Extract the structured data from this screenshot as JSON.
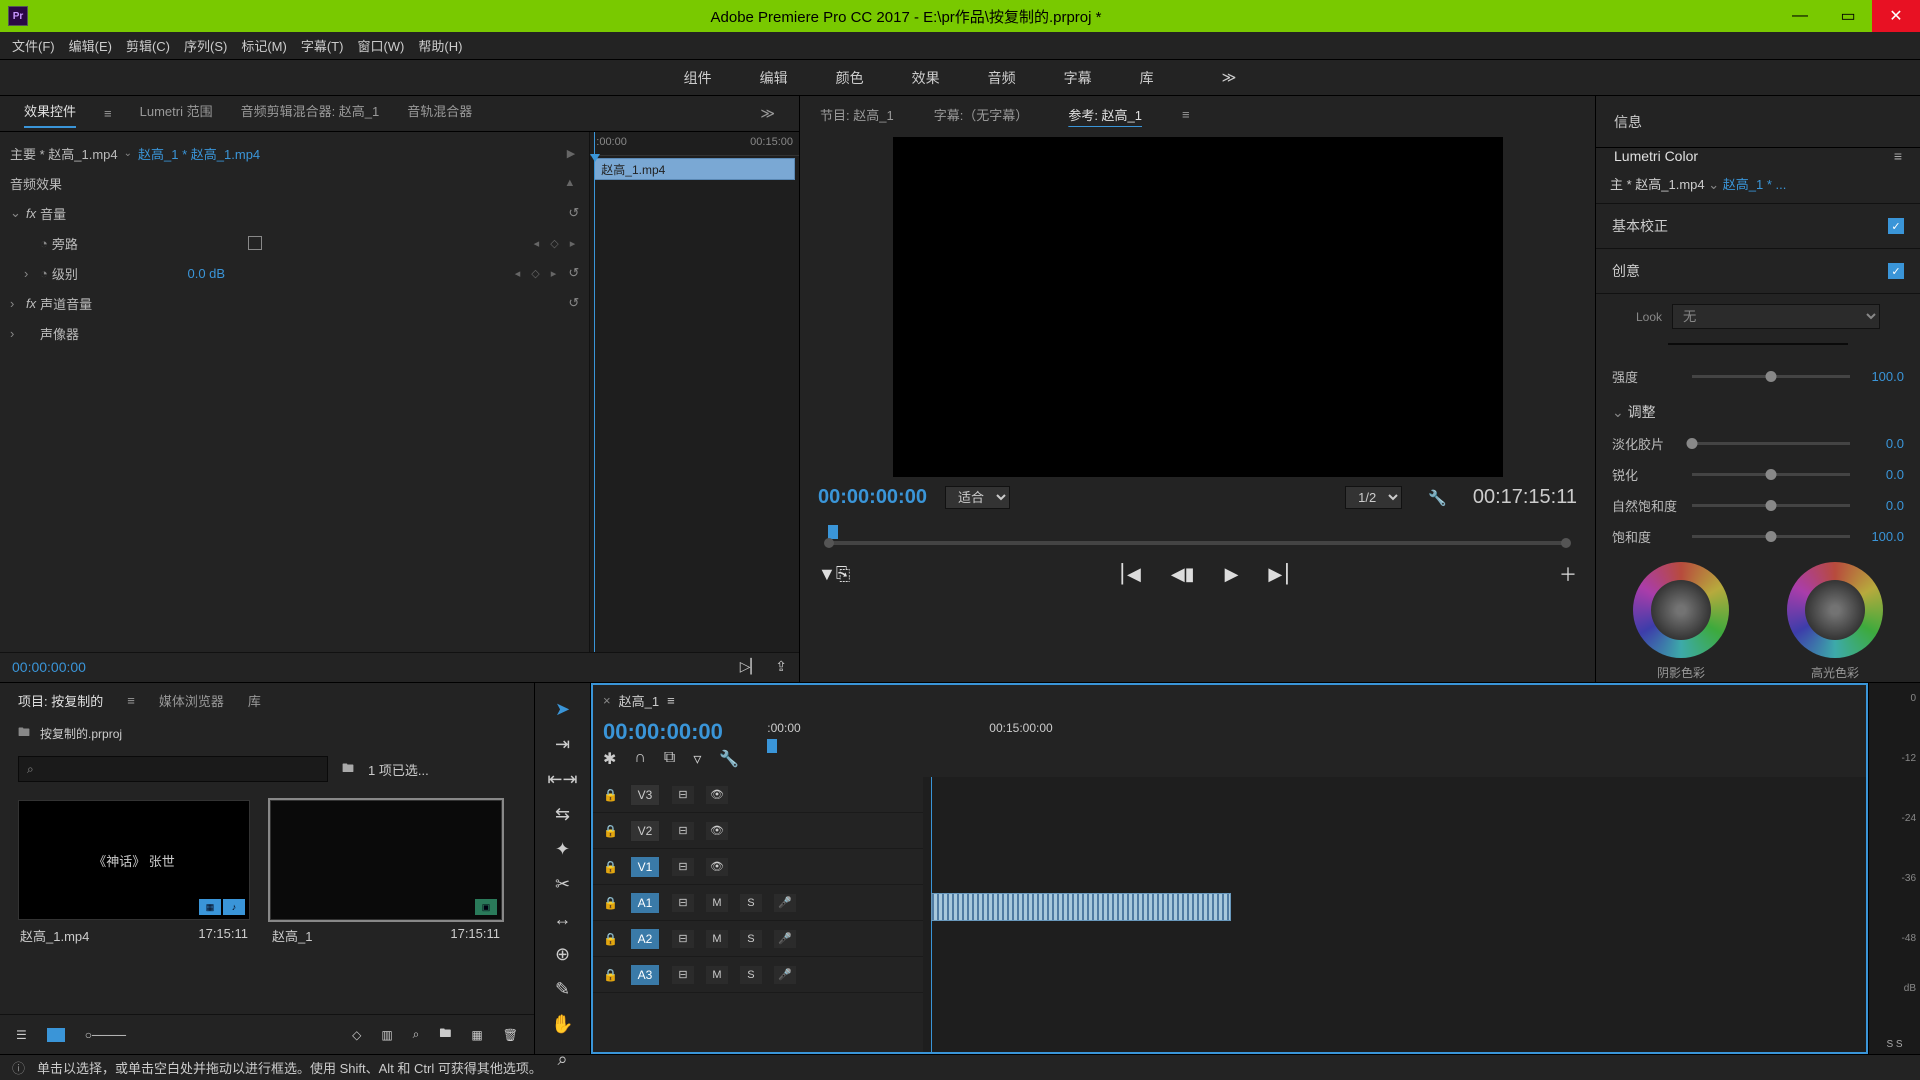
{
  "window": {
    "title": "Adobe Premiere Pro CC 2017 - E:\\pr作品\\按复制的.prproj *",
    "logo": "Pr"
  },
  "menubar": [
    "文件(F)",
    "编辑(E)",
    "剪辑(C)",
    "序列(S)",
    "标记(M)",
    "字幕(T)",
    "窗口(W)",
    "帮助(H)"
  ],
  "workspaces": [
    "组件",
    "编辑",
    "颜色",
    "效果",
    "音频",
    "字幕",
    "库"
  ],
  "effectControls": {
    "tabs": [
      "效果控件",
      "Lumetri 范围",
      "音频剪辑混合器: 赵高_1",
      "音轨混合器"
    ],
    "active": 0,
    "crumb1": "主要 * 赵高_1.mp4",
    "crumb2": "赵高_1 * 赵高_1.mp4",
    "sectionAudio": "音频效果",
    "fxVolume": "音量",
    "propBypass": "旁路",
    "propLevel": "级别",
    "levelValue": "0.0 dB",
    "fxChannel": "声道音量",
    "fxPanner": "声像器",
    "rulerStart": ":00:00",
    "rulerEnd": "00:15:00",
    "clipName": "赵高_1.mp4",
    "timecode": "00:00:00:00"
  },
  "monitor": {
    "tabs": {
      "program": "节目: 赵高_1",
      "captions": "字幕:（无字幕）",
      "reference": "参考: 赵高_1"
    },
    "activeTab": "reference",
    "timecode": "00:00:00:00",
    "fit": "适合",
    "res": "1/2",
    "duration": "00:17:15:11"
  },
  "rightPanel": {
    "info": "信息",
    "lumetri": "Lumetri Color",
    "crumb1": "主 * 赵高_1.mp4",
    "crumb2": "赵高_1 * ...",
    "basic": "基本校正",
    "creative": "创意",
    "look": "Look",
    "lookVal": "无",
    "intensity": "强度",
    "intensityVal": "100.0",
    "adjust": "调整",
    "fade": "淡化胶片",
    "fadeVal": "0.0",
    "sharpen": "锐化",
    "sharpenVal": "0.0",
    "vibrance": "自然饱和度",
    "vibranceVal": "0.0",
    "saturation": "饱和度",
    "saturationVal": "100.0",
    "shadowTint": "阴影色彩",
    "highlightTint": "高光色彩"
  },
  "project": {
    "tabs": [
      "项目: 按复制的",
      "媒体浏览器",
      "库"
    ],
    "file": "按复制的.prproj",
    "selection": "1 项已选...",
    "items": [
      {
        "name": "赵高_1.mp4",
        "dur": "17:15:11",
        "caption": "《神话》    张世"
      },
      {
        "name": "赵高_1",
        "dur": "17:15:11",
        "caption": ""
      }
    ]
  },
  "timeline": {
    "seq": "赵高_1",
    "timecode": "00:00:00:00",
    "rulerTicks": [
      ":00:00",
      "00:15:00:00"
    ],
    "videoTracks": [
      "V3",
      "V2",
      "V1"
    ],
    "audioTracks": [
      "A1",
      "A2",
      "A3"
    ],
    "meterMarks": [
      "0",
      "-12",
      "-24",
      "-36",
      "-48",
      "dB"
    ]
  },
  "status": "单击以选择，或单击空白处并拖动以进行框选。使用 Shift、Alt 和 Ctrl 可获得其他选项。"
}
